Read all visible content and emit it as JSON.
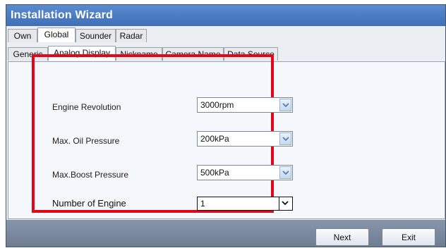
{
  "window": {
    "title": "Installation Wizard"
  },
  "tabs_top": [
    "Own",
    "Global",
    "Sounder",
    "Radar"
  ],
  "tabs_sub": [
    "Generic",
    "Analog Display",
    "Nickname",
    "Camera Name",
    "Data Source"
  ],
  "fields": [
    {
      "label": "Engine Revolution",
      "value": "3000rpm"
    },
    {
      "label": "Max. Oil Pressure",
      "value": "200kPa"
    },
    {
      "label": "Max.Boost Pressure",
      "value": "500kPa"
    },
    {
      "label": "Number of Engine",
      "value": "1"
    }
  ],
  "buttons": {
    "next": "Next",
    "exit": "Exit"
  },
  "colors": {
    "highlight_box": "#e3061a",
    "title_bar": "#4a7cc4"
  },
  "icons": {
    "dropdown": "chevron-down-icon"
  }
}
